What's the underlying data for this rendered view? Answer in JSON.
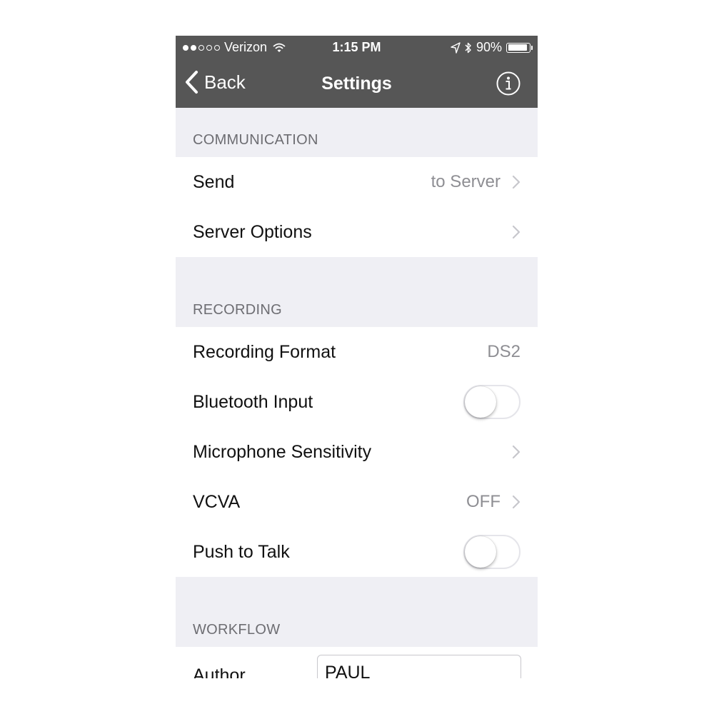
{
  "status_bar": {
    "carrier": "Verizon",
    "signal_bars_filled": 2,
    "signal_bars_total": 5,
    "time": "1:15 PM",
    "battery_percent": "90%",
    "battery_level": 0.9,
    "icons": [
      "wifi-icon",
      "location-arrow-icon",
      "bluetooth-icon",
      "battery-icon"
    ]
  },
  "nav_bar": {
    "back_label": "Back",
    "title": "Settings",
    "info_icon": "info-icon",
    "background": "#565656"
  },
  "sections": {
    "communication": {
      "header": "COMMUNICATION",
      "send": {
        "label": "Send",
        "value": "to Server"
      },
      "server_options": {
        "label": "Server Options"
      }
    },
    "recording": {
      "header": "RECORDING",
      "recording_format": {
        "label": "Recording Format",
        "value": "DS2"
      },
      "bluetooth_input": {
        "label": "Bluetooth Input",
        "on": false
      },
      "microphone_sensitivity": {
        "label": "Microphone Sensitivity"
      },
      "vcva": {
        "label": "VCVA",
        "value": "OFF"
      },
      "push_to_talk": {
        "label": "Push to Talk",
        "on": false
      }
    },
    "workflow": {
      "header": "WORKFLOW",
      "author": {
        "label": "Author",
        "value": "PAUL"
      }
    }
  },
  "colors": {
    "bar_background": "#565656",
    "group_background": "#efeff4",
    "secondary_text": "#8e8e93"
  }
}
